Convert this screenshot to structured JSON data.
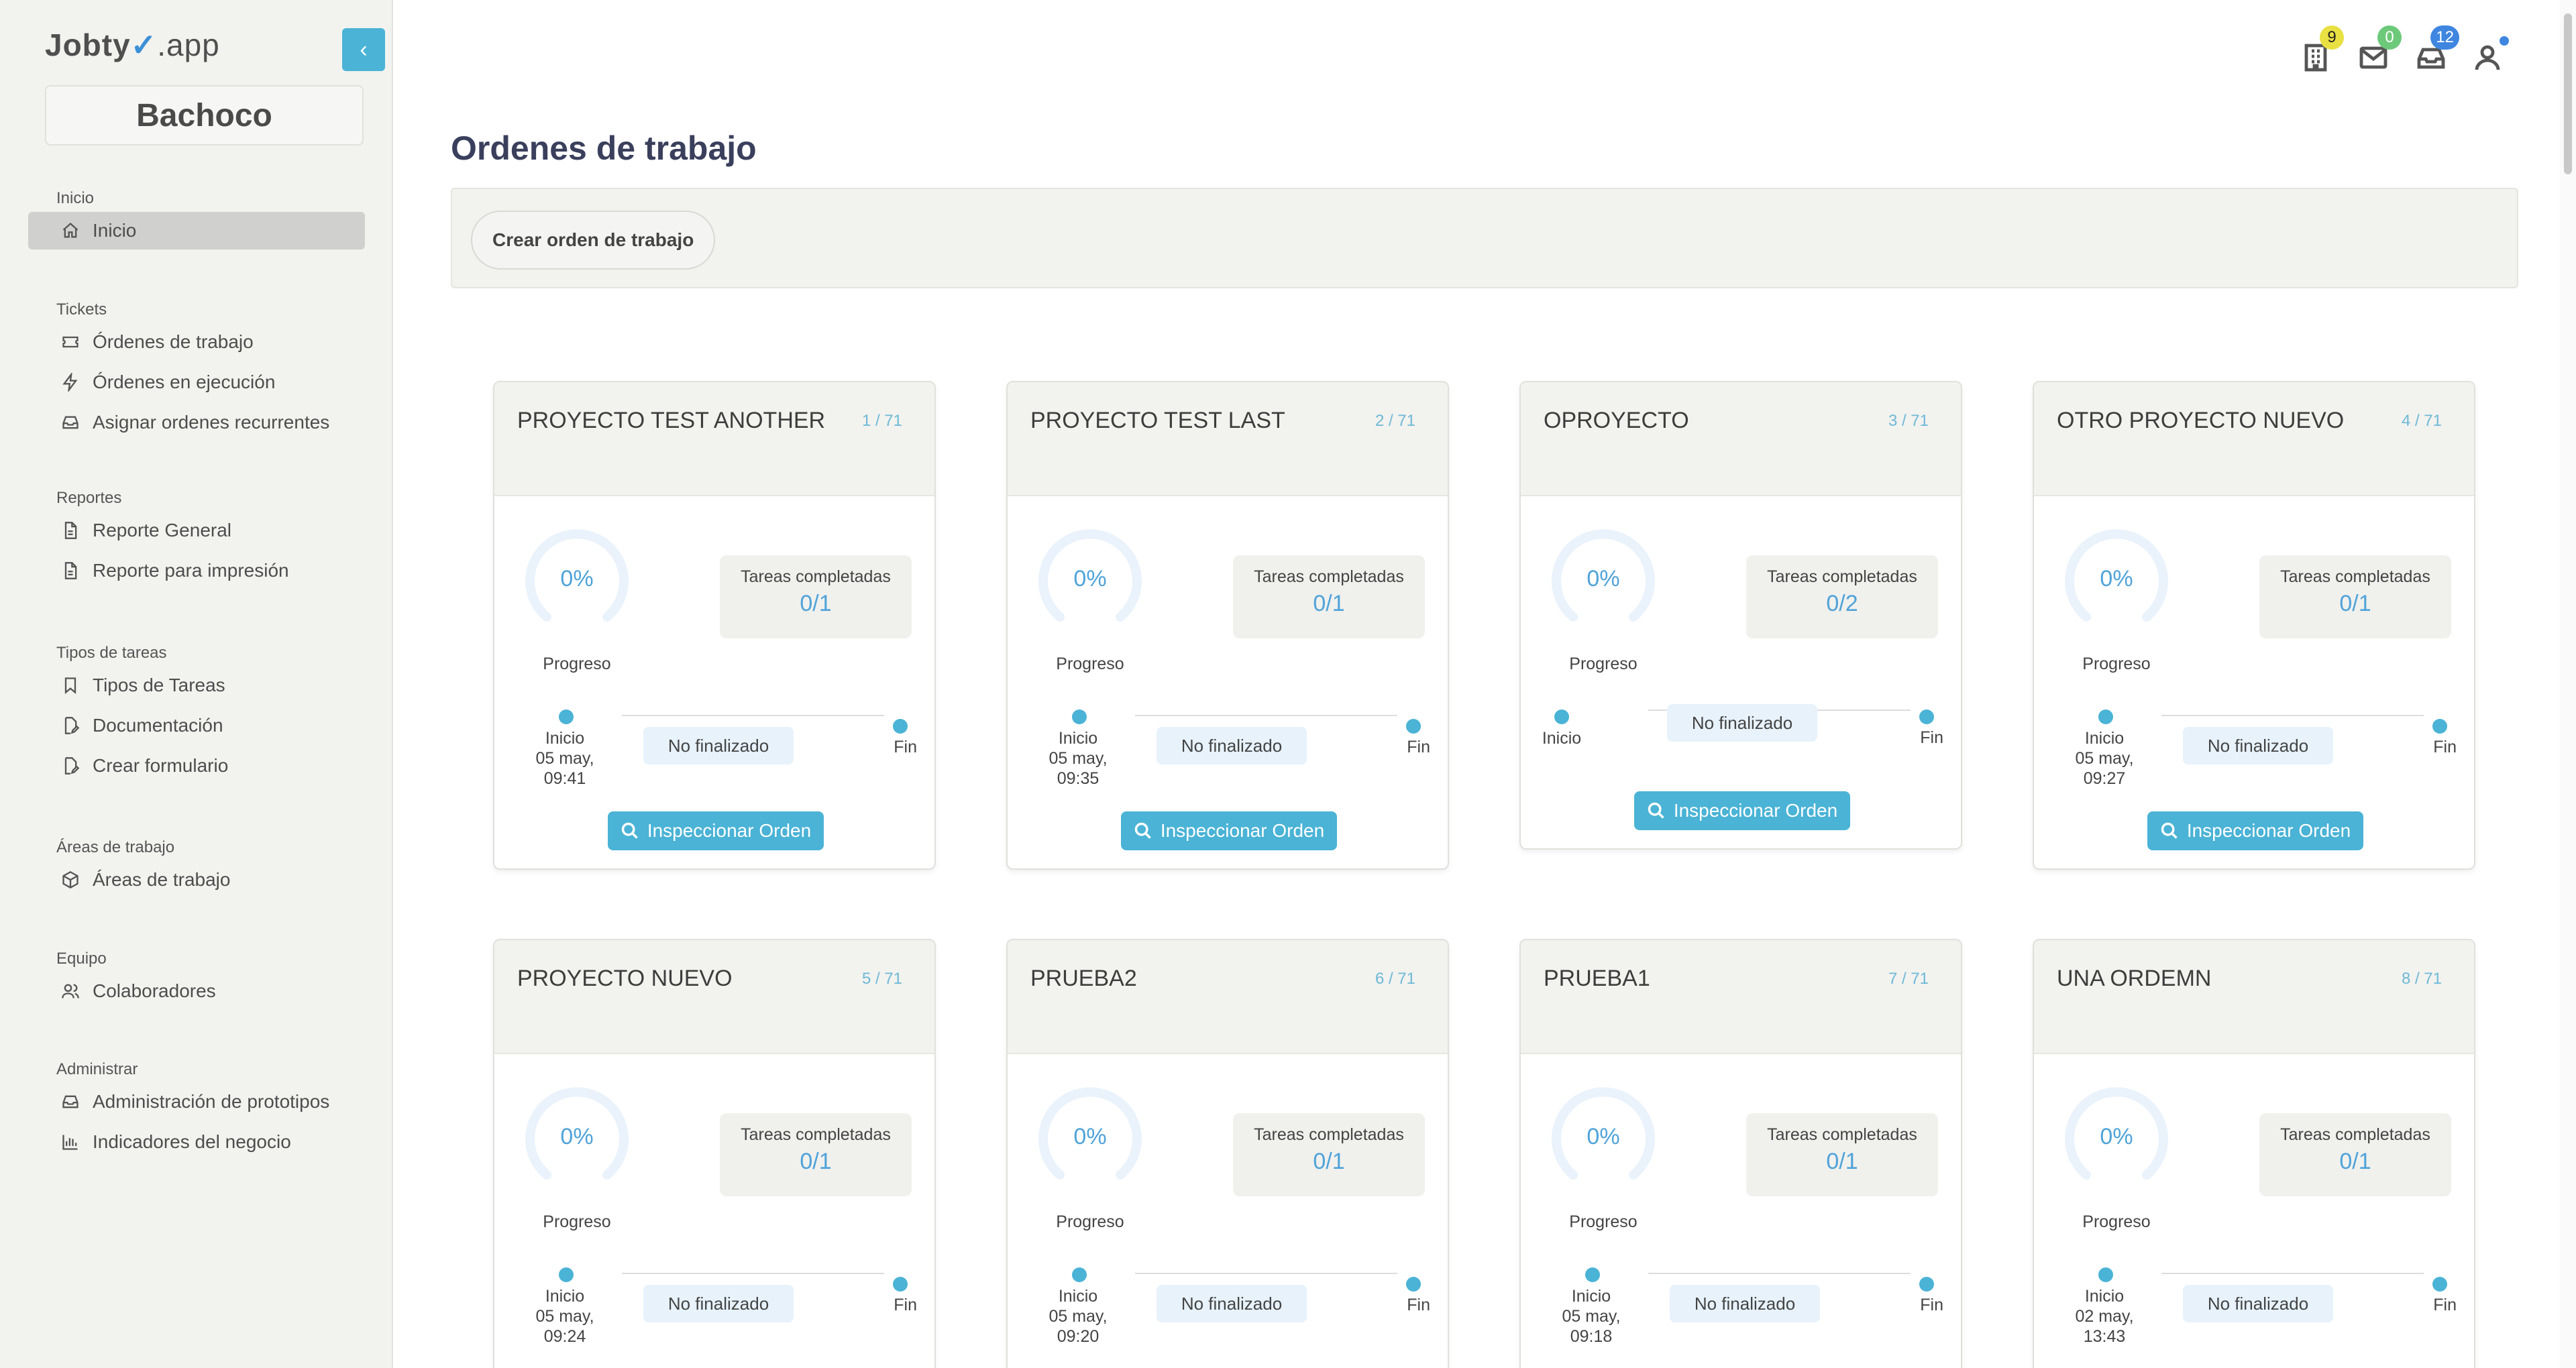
{
  "brand": {
    "prefix": "Jobty",
    "tick": "✓",
    "suffix": ".app"
  },
  "company": "Bachoco",
  "sidebar": {
    "sections": [
      {
        "heading": "Inicio",
        "items": [
          {
            "label": "Inicio",
            "icon": "home-icon",
            "active": true
          }
        ]
      },
      {
        "heading": "Tickets",
        "items": [
          {
            "label": "Órdenes de trabajo",
            "icon": "ticket-icon"
          },
          {
            "label": "Órdenes en ejecución",
            "icon": "bolt-icon"
          },
          {
            "label": "Asignar ordenes recurrentes",
            "icon": "inbox-icon"
          }
        ]
      },
      {
        "heading": "Reportes",
        "items": [
          {
            "label": "Reporte General",
            "icon": "file-icon"
          },
          {
            "label": "Reporte para impresión",
            "icon": "file-icon"
          }
        ]
      },
      {
        "heading": "Tipos de tareas",
        "items": [
          {
            "label": "Tipos de Tareas",
            "icon": "bookmark-icon"
          },
          {
            "label": "Documentación",
            "icon": "file-edit-icon"
          },
          {
            "label": "Crear formulario",
            "icon": "file-edit-icon"
          }
        ]
      },
      {
        "heading": "Áreas de trabajo",
        "items": [
          {
            "label": "Áreas de trabajo",
            "icon": "box-icon"
          }
        ]
      },
      {
        "heading": "Equipo",
        "items": [
          {
            "label": "Colaboradores",
            "icon": "users-icon"
          }
        ]
      },
      {
        "heading": "Administrar",
        "items": [
          {
            "label": "Administración de prototipos",
            "icon": "inbox-icon"
          },
          {
            "label": "Indicadores del negocio",
            "icon": "chart-icon"
          }
        ]
      }
    ]
  },
  "topbar": {
    "buildings_badge": "9",
    "mail_badge": "0",
    "messages_badge": "12"
  },
  "main": {
    "title": "Ordenes de trabajo",
    "create_button": "Crear orden de trabajo",
    "progress_label": "Progreso",
    "tasks_label": "Tareas completadas",
    "status_label": "No finalizado",
    "start_label": "Inicio",
    "end_label": "Fin",
    "inspect_label": "Inspeccionar Orden",
    "cards": [
      {
        "title": "PROYECTO TEST ANOTHER",
        "count": "1 / 71",
        "progress": "0%",
        "tasks": "0/1",
        "start_date": "05 may, 09:41"
      },
      {
        "title": "PROYECTO TEST LAST",
        "count": "2 / 71",
        "progress": "0%",
        "tasks": "0/1",
        "start_date": "05 may, 09:35"
      },
      {
        "title": "OPROYECTO",
        "count": "3 / 71",
        "progress": "0%",
        "tasks": "0/2",
        "start_date": ""
      },
      {
        "title": "OTRO PROYECTO NUEVO",
        "count": "4 / 71",
        "progress": "0%",
        "tasks": "0/1",
        "start_date": "05 may, 09:27"
      },
      {
        "title": "PROYECTO NUEVO",
        "count": "5 / 71",
        "progress": "0%",
        "tasks": "0/1",
        "start_date": "05 may, 09:24"
      },
      {
        "title": "PRUEBA2",
        "count": "6 / 71",
        "progress": "0%",
        "tasks": "0/1",
        "start_date": "05 may, 09:20"
      },
      {
        "title": "PRUEBA1",
        "count": "7 / 71",
        "progress": "0%",
        "tasks": "0/1",
        "start_date": "05 may, 09:18"
      },
      {
        "title": "UNA ORDEMN",
        "count": "8 / 71",
        "progress": "0%",
        "tasks": "0/1",
        "start_date": "02 may, 13:43"
      }
    ]
  },
  "colors": {
    "accent": "#4ab3d6",
    "progress_text": "#4fa3d9",
    "sidebar_bg": "#f2f2ef"
  }
}
